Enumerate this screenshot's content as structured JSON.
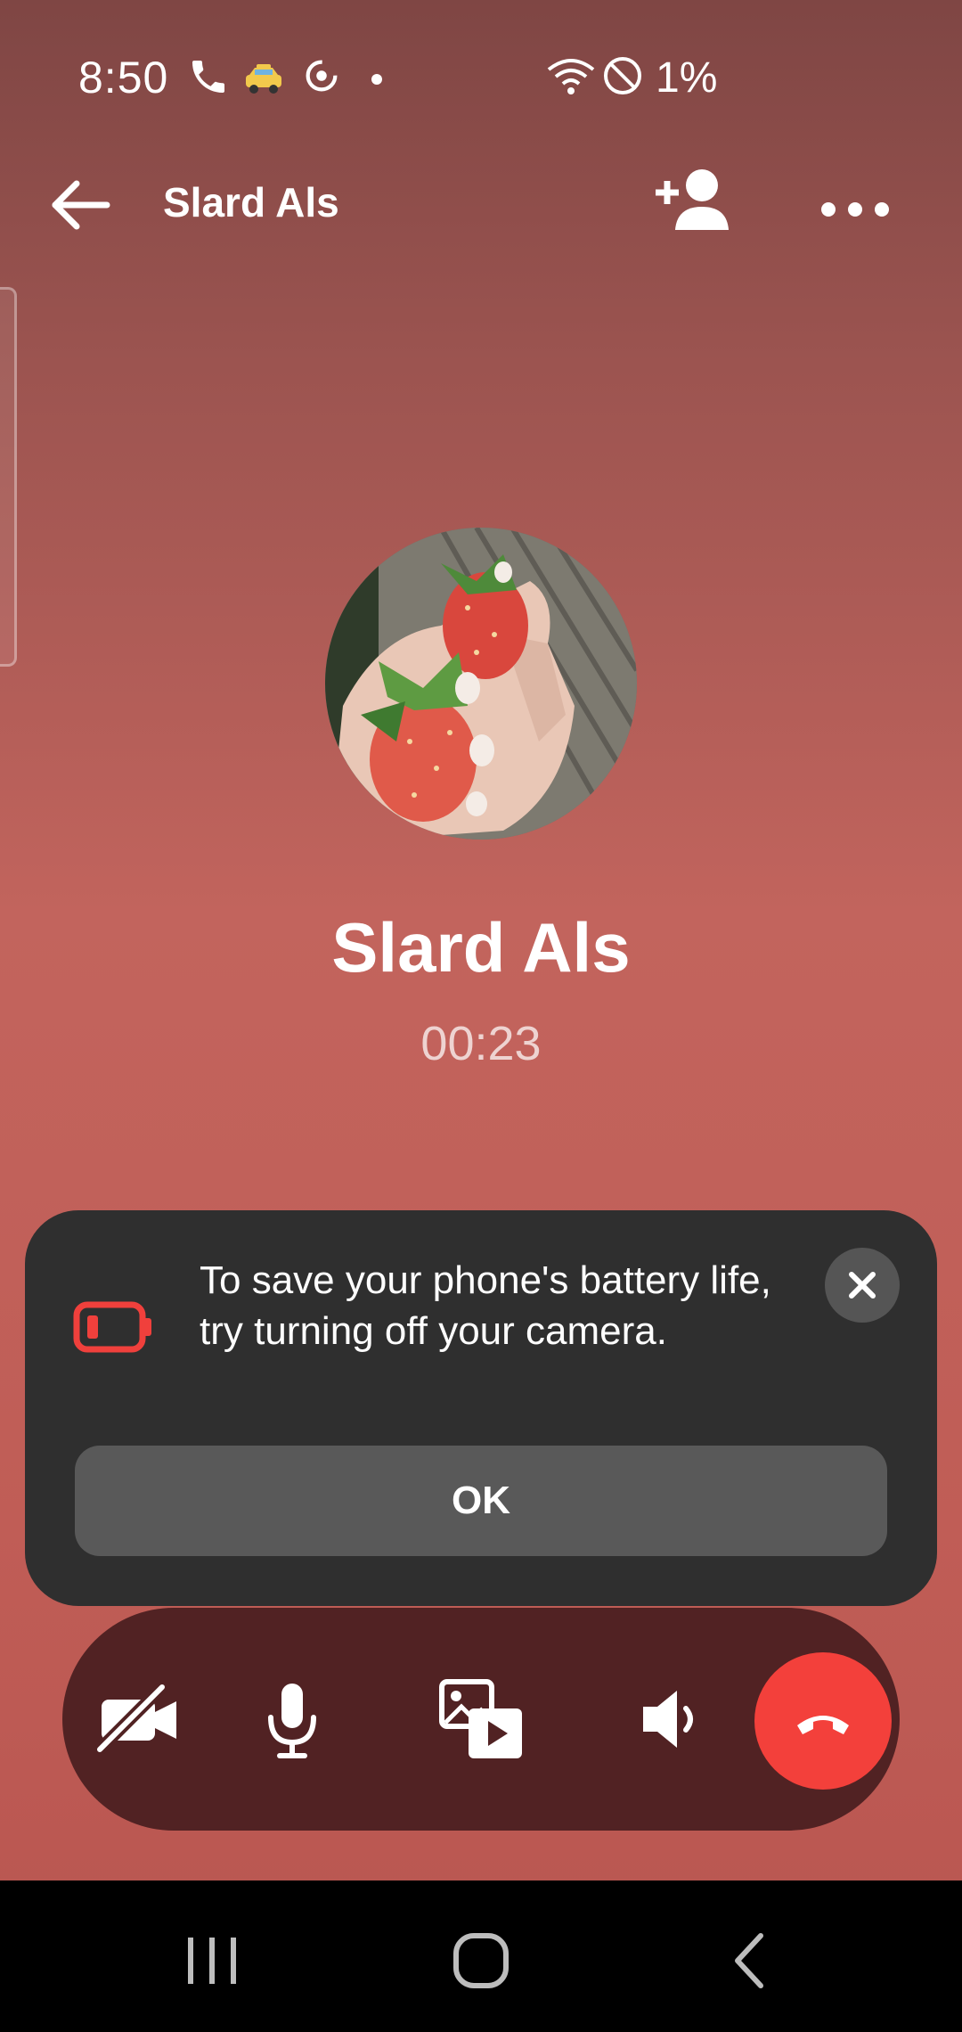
{
  "status_bar": {
    "time": "8:50",
    "battery": "1%",
    "icons": [
      "phone-icon",
      "taxi-icon",
      "sync-icon",
      "dot-icon",
      "wifi-icon",
      "do-not-disturb-icon"
    ]
  },
  "header": {
    "title": "Slard Als",
    "icons": [
      "back-arrow-icon",
      "add-person-icon",
      "more-icon"
    ]
  },
  "call": {
    "caller_name": "Slard Als",
    "timer": "00:23",
    "avatar": "strawberries-photo"
  },
  "tip": {
    "message": "To save your phone's battery life, try turning off your camera.",
    "ok_label": "OK",
    "icons": [
      "low-battery-icon",
      "close-icon"
    ]
  },
  "controls": {
    "items": [
      "camera-off-icon",
      "microphone-icon",
      "media-share-icon",
      "speaker-icon",
      "end-call-icon"
    ]
  },
  "nav": {
    "items": [
      "recent-apps-icon",
      "home-icon",
      "back-icon"
    ]
  },
  "colors": {
    "accent_end_call": "#f3403b",
    "low_battery": "#f0403c",
    "card_bg": "#2f2f2f",
    "controls_bg": "#512223"
  }
}
